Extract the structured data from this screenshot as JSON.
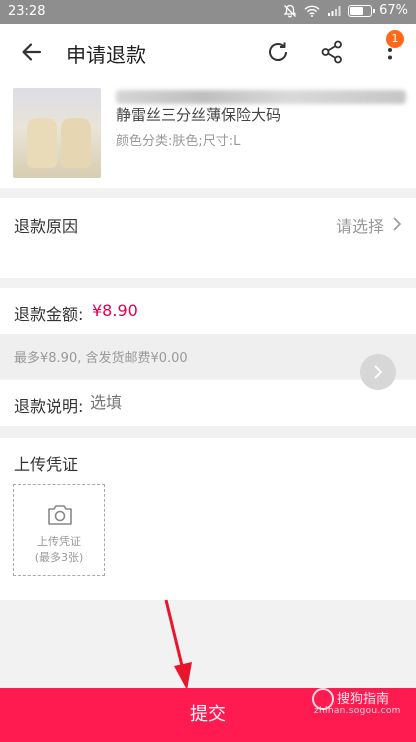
{
  "status_bar": {
    "time": "23:28",
    "battery": "67%",
    "battery_level": 0.67
  },
  "nav": {
    "title": "申请退款",
    "badge_count": "1"
  },
  "product": {
    "name_visible": "静雷丝三分丝薄保险大码",
    "sku": "颜色分类:肤色;尺寸:L"
  },
  "refund_reason": {
    "label": "退款原因",
    "placeholder": "请选择"
  },
  "refund_amount": {
    "label": "退款金额:",
    "value": "¥8.90"
  },
  "hint": {
    "text": "最多¥8.90, 含发货邮费¥0.00"
  },
  "refund_desc": {
    "label": "退款说明:",
    "placeholder": "选填"
  },
  "upload": {
    "label": "上传凭证",
    "box_line1": "上传凭证",
    "box_line2": "(最多3张)"
  },
  "submit": {
    "label": "提交"
  },
  "watermark": {
    "brand": "搜狗指南",
    "url": "zhinan.sogou.com"
  },
  "colors": {
    "accent": "#ff1a50",
    "price": "#e5004f",
    "badge": "#ff6a1a"
  }
}
